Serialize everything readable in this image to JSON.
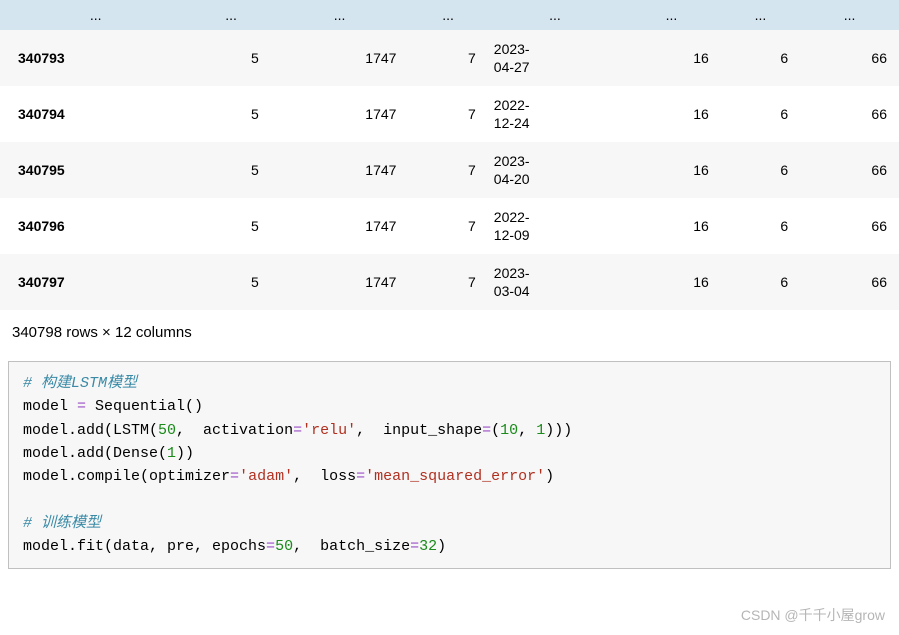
{
  "table": {
    "ellipsis": "...",
    "rows": [
      {
        "idx": "340793",
        "c1": "5",
        "c2": "1747",
        "c3": "7",
        "date_l1": "2023-",
        "date_l2": "04-27",
        "c5": "16",
        "c6": "6",
        "c7": "66"
      },
      {
        "idx": "340794",
        "c1": "5",
        "c2": "1747",
        "c3": "7",
        "date_l1": "2022-",
        "date_l2": "12-24",
        "c5": "16",
        "c6": "6",
        "c7": "66"
      },
      {
        "idx": "340795",
        "c1": "5",
        "c2": "1747",
        "c3": "7",
        "date_l1": "2023-",
        "date_l2": "04-20",
        "c5": "16",
        "c6": "6",
        "c7": "66"
      },
      {
        "idx": "340796",
        "c1": "5",
        "c2": "1747",
        "c3": "7",
        "date_l1": "2022-",
        "date_l2": "12-09",
        "c5": "16",
        "c6": "6",
        "c7": "66"
      },
      {
        "idx": "340797",
        "c1": "5",
        "c2": "1747",
        "c3": "7",
        "date_l1": "2023-",
        "date_l2": "03-04",
        "c5": "16",
        "c6": "6",
        "c7": "66"
      }
    ]
  },
  "summary": "340798 rows × 12 columns",
  "code": {
    "comment1": "# 构建LSTM模型",
    "l2_model": "model ",
    "l2_eq": "=",
    "l2_seq": " Sequential()",
    "l3_a": "model.add(LSTM(",
    "l3_n1": "50",
    "l3_b": ",  activation",
    "l3_eq1": "=",
    "l3_s1": "'relu'",
    "l3_c": ",  input_shape",
    "l3_eq2": "=",
    "l3_d": "(",
    "l3_n2": "10",
    "l3_e": ", ",
    "l3_n3": "1",
    "l3_f": ")))",
    "l4_a": "model.add(Dense(",
    "l4_n1": "1",
    "l4_b": "))",
    "l5_a": "model.compile(optimizer",
    "l5_eq1": "=",
    "l5_s1": "'adam'",
    "l5_b": ",  loss",
    "l5_eq2": "=",
    "l5_s2": "'mean_squared_error'",
    "l5_c": ")",
    "comment2": "# 训练模型",
    "l7_a": "model.fit(data, pre, epochs",
    "l7_eq1": "=",
    "l7_n1": "50",
    "l7_b": ",  batch_size",
    "l7_eq2": "=",
    "l7_n2": "32",
    "l7_c": ")"
  },
  "watermark": "CSDN @千千小屋grow"
}
